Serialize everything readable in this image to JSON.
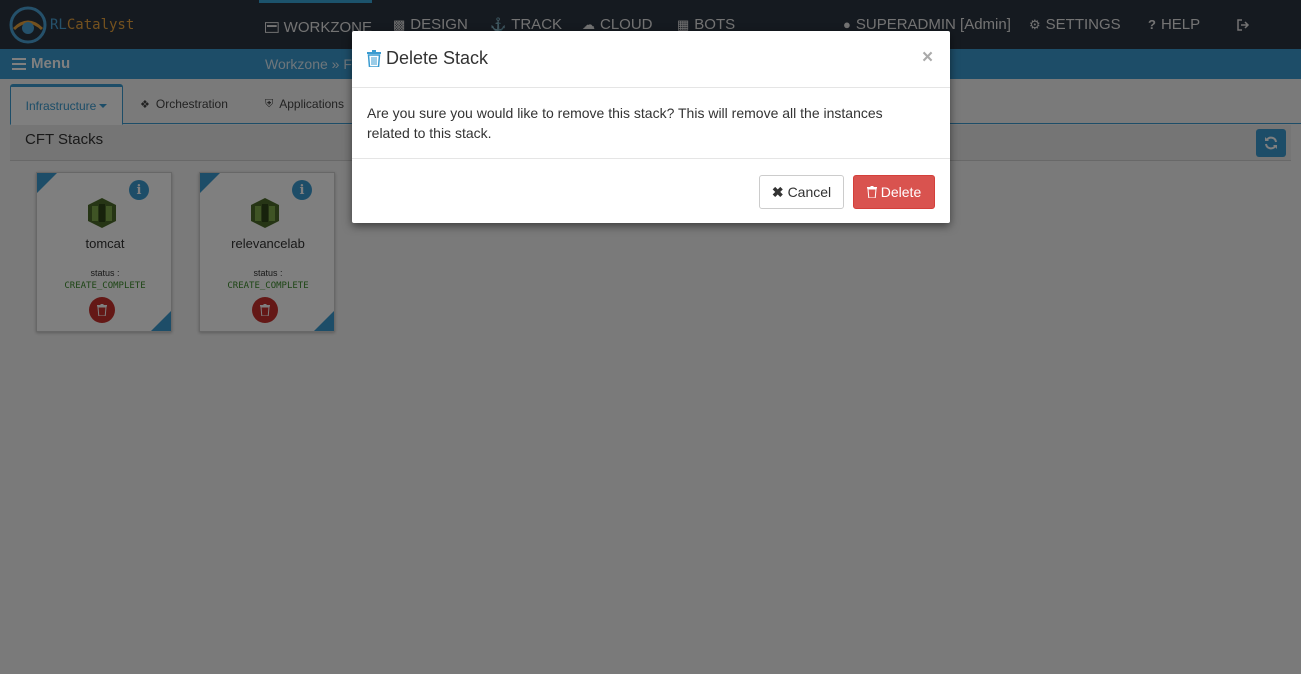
{
  "app": {
    "logo_text_a": "RL",
    "logo_text_b": "Catalyst"
  },
  "nav": {
    "items": [
      {
        "label": "WORKZONE",
        "icon": "monitor-icon"
      },
      {
        "label": "DESIGN",
        "icon": "puzzle-icon"
      },
      {
        "label": "TRACK",
        "icon": "anchor-icon"
      },
      {
        "label": "CLOUD",
        "icon": "cloud-icon"
      },
      {
        "label": "BOTS",
        "icon": "bots-icon"
      }
    ],
    "user": "SUPERADMIN [Admin]",
    "settings": "SETTINGS",
    "help": "HELP",
    "help_glyph": "?"
  },
  "subbar": {
    "menu_label": "Menu",
    "breadcrumb": "Workzone » F"
  },
  "tabs": [
    {
      "label": "Infrastructure"
    },
    {
      "label": "Orchestration"
    },
    {
      "label": "Applications"
    }
  ],
  "panel": {
    "title": "CFT Stacks"
  },
  "stacks": [
    {
      "name": "tomcat",
      "status_label": "status :",
      "status": "CREATE_COMPLETE"
    },
    {
      "name": "relevancelab",
      "status_label": "status :",
      "status": "CREATE_COMPLETE"
    }
  ],
  "modal": {
    "title": "Delete Stack",
    "close": "×",
    "body": "Are you sure you would like to remove this stack? This will remove all the instances related to this stack.",
    "cancel_label": "Cancel",
    "delete_label": "Delete"
  },
  "colors": {
    "accent": "#3a9bd0",
    "danger": "#d9534f",
    "status_ok": "#3a8a2a",
    "nav_bg": "#2b3440"
  }
}
